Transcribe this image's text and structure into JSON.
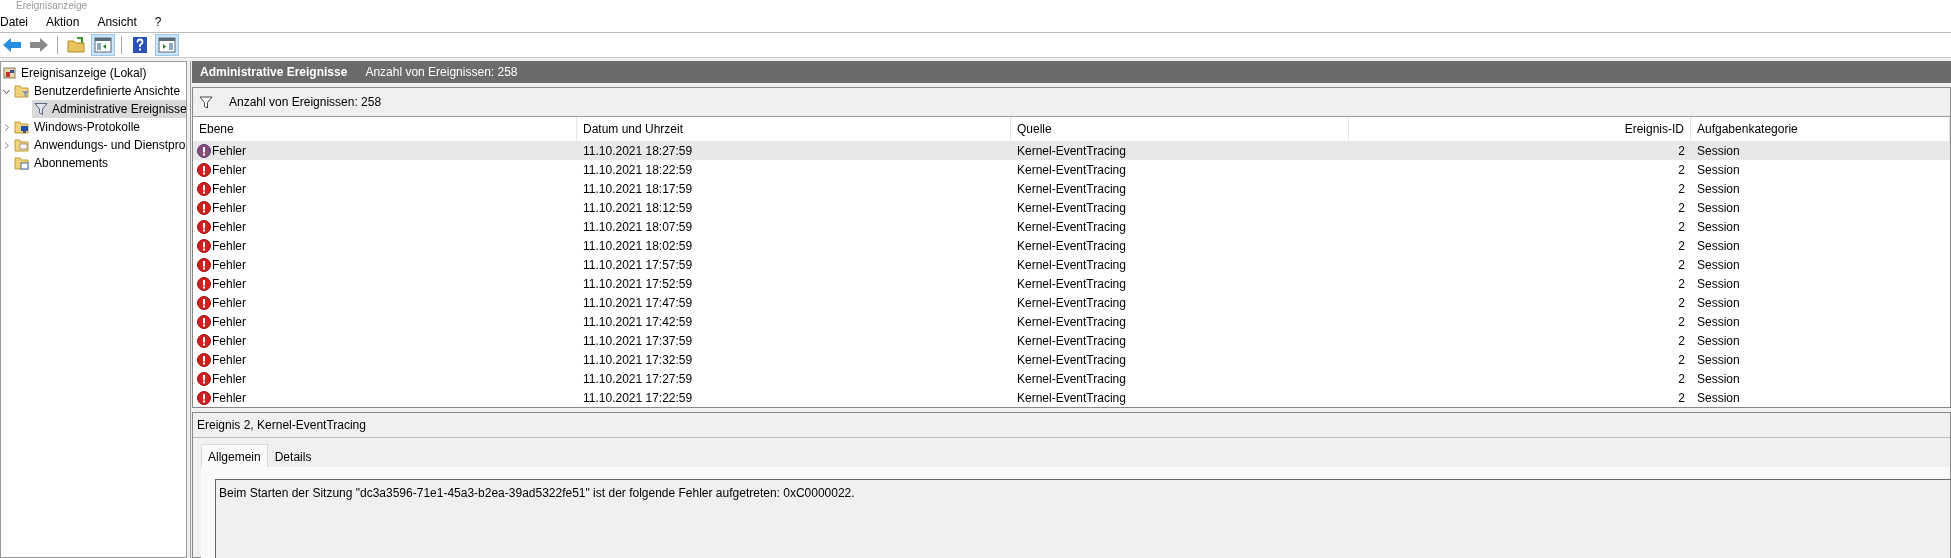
{
  "window": {
    "title": "Ereignisanzeige"
  },
  "menu": [
    "Datei",
    "Aktion",
    "Ansicht",
    "?"
  ],
  "toolbar": [
    {
      "kind": "back",
      "pressed": false
    },
    {
      "kind": "forward",
      "pressed": false
    },
    {
      "kind": "sep"
    },
    {
      "kind": "folder-up",
      "pressed": false
    },
    {
      "kind": "tree-pane",
      "pressed": true
    },
    {
      "kind": "sep"
    },
    {
      "kind": "help",
      "pressed": false
    },
    {
      "kind": "action-pane",
      "pressed": true
    }
  ],
  "tree": [
    {
      "label": "Ereignisanzeige (Lokal)",
      "kind": "computer",
      "selected": false,
      "children": [
        {
          "label": "Benutzerdefinierte Ansichte",
          "kind": "folder-filter",
          "selected": false,
          "expanded": true,
          "children": [
            {
              "label": "Administrative Ereignisse",
              "kind": "filter",
              "selected": true
            }
          ]
        },
        {
          "label": "Windows-Protokolle",
          "kind": "folder-log",
          "selected": false,
          "expanded": false
        },
        {
          "label": "Anwendungs- und Dienstpro",
          "kind": "folder",
          "selected": false,
          "expanded": false
        },
        {
          "label": "Abonnements",
          "kind": "folder-sub",
          "selected": false
        }
      ]
    }
  ],
  "header": {
    "title": "Administrative Ereignisse",
    "count": "Anzahl von Ereignissen: 258"
  },
  "filter_bar": {
    "text": "Anzahl von Ereignissen: 258"
  },
  "table": {
    "columns": [
      "Ebene",
      "Datum und Uhrzeit",
      "Quelle",
      "Ereignis-ID",
      "Aufgabenkategorie"
    ],
    "rows": [
      {
        "level": "Fehler",
        "date": "11.10.2021 18:27:59",
        "source": "Kernel-EventTracing",
        "id": "2",
        "category": "Session",
        "selected": true
      },
      {
        "level": "Fehler",
        "date": "11.10.2021 18:22:59",
        "source": "Kernel-EventTracing",
        "id": "2",
        "category": "Session",
        "selected": false
      },
      {
        "level": "Fehler",
        "date": "11.10.2021 18:17:59",
        "source": "Kernel-EventTracing",
        "id": "2",
        "category": "Session",
        "selected": false
      },
      {
        "level": "Fehler",
        "date": "11.10.2021 18:12:59",
        "source": "Kernel-EventTracing",
        "id": "2",
        "category": "Session",
        "selected": false
      },
      {
        "level": "Fehler",
        "date": "11.10.2021 18:07:59",
        "source": "Kernel-EventTracing",
        "id": "2",
        "category": "Session",
        "selected": false
      },
      {
        "level": "Fehler",
        "date": "11.10.2021 18:02:59",
        "source": "Kernel-EventTracing",
        "id": "2",
        "category": "Session",
        "selected": false
      },
      {
        "level": "Fehler",
        "date": "11.10.2021 17:57:59",
        "source": "Kernel-EventTracing",
        "id": "2",
        "category": "Session",
        "selected": false
      },
      {
        "level": "Fehler",
        "date": "11.10.2021 17:52:59",
        "source": "Kernel-EventTracing",
        "id": "2",
        "category": "Session",
        "selected": false
      },
      {
        "level": "Fehler",
        "date": "11.10.2021 17:47:59",
        "source": "Kernel-EventTracing",
        "id": "2",
        "category": "Session",
        "selected": false
      },
      {
        "level": "Fehler",
        "date": "11.10.2021 17:42:59",
        "source": "Kernel-EventTracing",
        "id": "2",
        "category": "Session",
        "selected": false
      },
      {
        "level": "Fehler",
        "date": "11.10.2021 17:37:59",
        "source": "Kernel-EventTracing",
        "id": "2",
        "category": "Session",
        "selected": false
      },
      {
        "level": "Fehler",
        "date": "11.10.2021 17:32:59",
        "source": "Kernel-EventTracing",
        "id": "2",
        "category": "Session",
        "selected": false
      },
      {
        "level": "Fehler",
        "date": "11.10.2021 17:27:59",
        "source": "Kernel-EventTracing",
        "id": "2",
        "category": "Session",
        "selected": false
      },
      {
        "level": "Fehler",
        "date": "11.10.2021 17:22:59",
        "source": "Kernel-EventTracing",
        "id": "2",
        "category": "Session",
        "selected": false
      }
    ]
  },
  "detail": {
    "title": "Ereignis 2, Kernel-EventTracing",
    "tabs": [
      {
        "label": "Allgemein",
        "selected": true
      },
      {
        "label": "Details",
        "selected": false
      }
    ],
    "message": "Beim Starten der Sitzung \"dc3a3596-71e1-45a3-b2ea-39ad5322fe51\" ist der folgende Fehler aufgetreten: 0xC0000022."
  }
}
